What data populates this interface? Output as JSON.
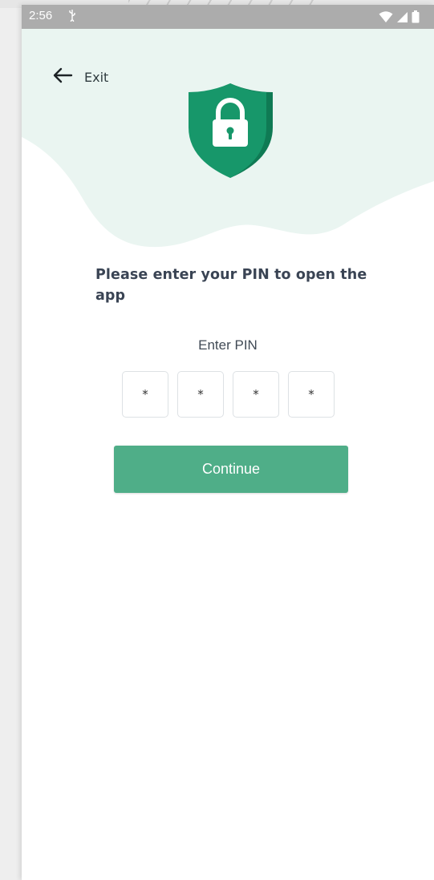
{
  "status_bar": {
    "time": "2:56",
    "usb_icon": "usb-icon",
    "wifi_icon": "wifi-icon",
    "signal_icon": "signal-icon",
    "battery_icon": "battery-icon"
  },
  "header": {
    "back_icon": "arrow-left-icon",
    "exit_label": "Exit"
  },
  "illustration": {
    "icon": "shield-lock-icon",
    "colors": {
      "shield": "#17976a",
      "shield_dark": "#0f7a54",
      "blob": "#eaf5f1"
    }
  },
  "form": {
    "prompt": "Please enter your PIN to open the app",
    "pin_label": "Enter PIN",
    "pin_digits": [
      "*",
      "*",
      "*",
      "*"
    ],
    "continue_label": "Continue"
  },
  "colors": {
    "accent": "#4fae88",
    "text": "#3a4454"
  }
}
